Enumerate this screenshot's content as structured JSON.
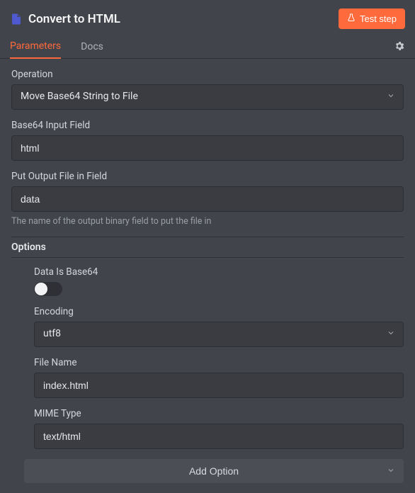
{
  "header": {
    "title": "Convert to HTML",
    "test_button_label": "Test step"
  },
  "tabs": {
    "parameters": "Parameters",
    "docs": "Docs"
  },
  "fields": {
    "operation": {
      "label": "Operation",
      "value": "Move Base64 String to File"
    },
    "base64_input": {
      "label": "Base64 Input Field",
      "value": "html"
    },
    "output_field": {
      "label": "Put Output File in Field",
      "value": "data",
      "helper": "The name of the output binary field to put the file in"
    }
  },
  "options": {
    "header": "Options",
    "data_is_base64": {
      "label": "Data Is Base64",
      "value": false
    },
    "encoding": {
      "label": "Encoding",
      "value": "utf8"
    },
    "file_name": {
      "label": "File Name",
      "value": "index.html"
    },
    "mime_type": {
      "label": "MIME Type",
      "value": "text/html"
    },
    "add_option_label": "Add Option"
  },
  "colors": {
    "accent": "#ff6a3d",
    "icon_primary": "#4f5ad1"
  }
}
